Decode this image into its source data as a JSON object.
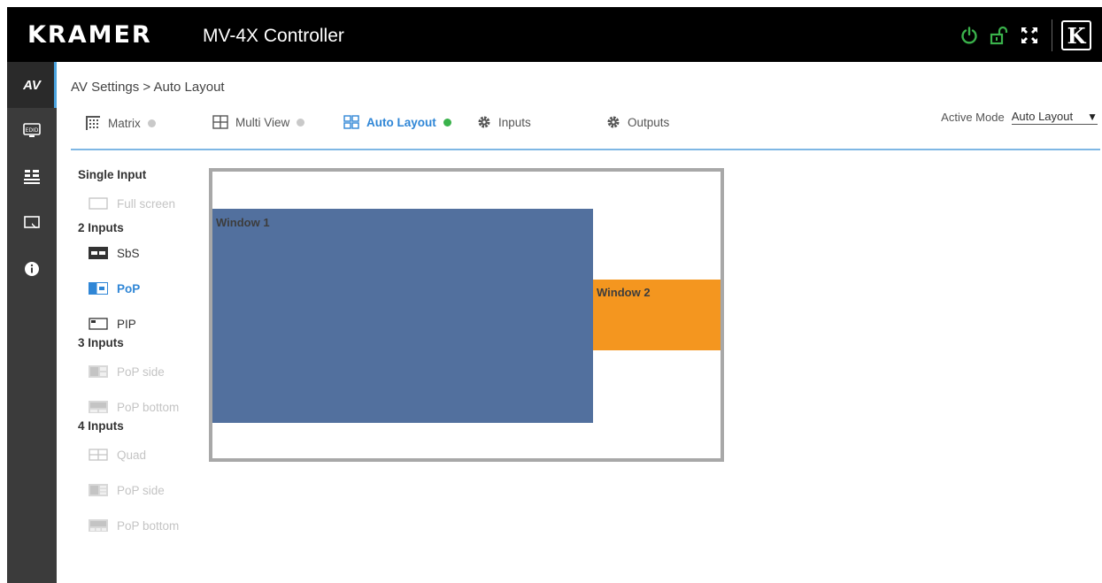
{
  "header": {
    "brand": "KRAMER",
    "app_title": "MV-4X Controller",
    "logo_letter": "K",
    "icons": [
      "power-icon",
      "unlock-icon",
      "fullscreen-icon",
      "kramer-logo"
    ]
  },
  "sidenav": {
    "items": [
      {
        "label": "AV",
        "icon": "av-text",
        "active": true
      },
      {
        "label": "",
        "icon": "edid-icon"
      },
      {
        "label": "",
        "icon": "device-settings-icon"
      },
      {
        "label": "",
        "icon": "display-icon"
      },
      {
        "label": "",
        "icon": "info-icon"
      }
    ],
    "edid_text": "EDID"
  },
  "breadcrumb": "AV Settings > Auto Layout",
  "tabs": [
    {
      "label": "Matrix",
      "icon": "matrix-icon",
      "status": "inactive"
    },
    {
      "label": "Multi View",
      "icon": "multiview-icon",
      "status": "inactive"
    },
    {
      "label": "Auto Layout",
      "icon": "autolayout-icon",
      "status": "active"
    },
    {
      "label": "Inputs",
      "icon": "gear-icon"
    },
    {
      "label": "Outputs",
      "icon": "gear-icon"
    }
  ],
  "active_mode": {
    "label": "Active Mode",
    "value": "Auto Layout"
  },
  "layouts": {
    "single": {
      "title": "Single Input",
      "options": [
        {
          "label": "Full screen",
          "state": "disabled"
        }
      ]
    },
    "two": {
      "title": "2 Inputs",
      "options": [
        {
          "label": "SbS",
          "state": "enabled"
        },
        {
          "label": "PoP",
          "state": "selected"
        },
        {
          "label": "PIP",
          "state": "enabled"
        }
      ]
    },
    "three": {
      "title": "3 Inputs",
      "options": [
        {
          "label": "PoP side",
          "state": "disabled"
        },
        {
          "label": "PoP bottom",
          "state": "disabled"
        }
      ]
    },
    "four": {
      "title": "4 Inputs",
      "options": [
        {
          "label": "Quad",
          "state": "disabled"
        },
        {
          "label": "PoP side",
          "state": "disabled"
        },
        {
          "label": "PoP bottom",
          "state": "disabled"
        }
      ]
    }
  },
  "preview": {
    "window1": {
      "label": "Window 1",
      "color": "#52709e"
    },
    "window2": {
      "label": "Window 2",
      "color": "#f4961f"
    }
  },
  "colors": {
    "accent": "#2f86d6",
    "active_dot": "#3ab24b",
    "power": "#3ab24b"
  }
}
